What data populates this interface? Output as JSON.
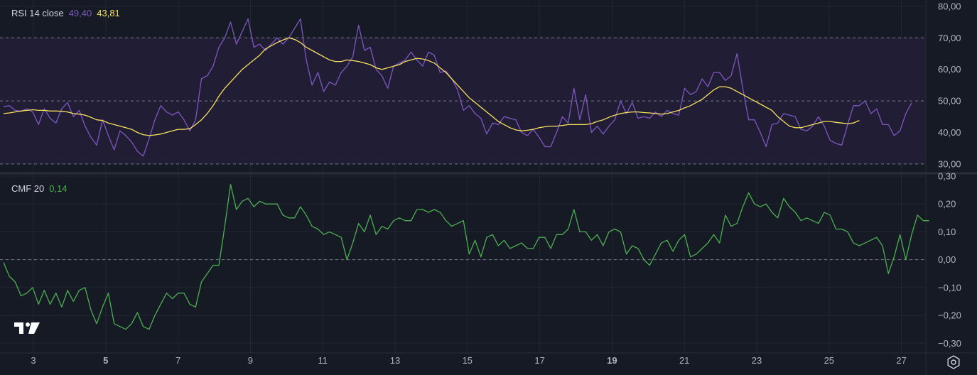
{
  "chart_data": [
    {
      "type": "line",
      "title": "RSI 14 close",
      "indicator": "RSI",
      "legend_values": [
        "49,40",
        "43,81"
      ],
      "y_ticks": [
        "80,00",
        "70,00",
        "60,00",
        "50,00",
        "40,00",
        "30,00"
      ],
      "ylim": [
        27.5,
        82
      ],
      "bands": [
        30,
        50,
        70
      ],
      "series": [
        {
          "color": "#7e57c2",
          "values": [
            48.2,
            48.5,
            47.0,
            46.7,
            47.5,
            46.5,
            42.5,
            47.5,
            44.5,
            43.0,
            47.5,
            49.5,
            45.0,
            47.0,
            42.0,
            38.5,
            36.0,
            44.0,
            39.0,
            34.5,
            40.5,
            39.0,
            37.0,
            34.0,
            32.5,
            38.0,
            44.0,
            48.5,
            46.5,
            45.5,
            46.5,
            44.0,
            40.5,
            44.0,
            57.0,
            58.0,
            61.0,
            67.0,
            70.0,
            75.0,
            68.0,
            72.0,
            76.0,
            67.0,
            68.0,
            66.0,
            68.0,
            70.0,
            68.0,
            70.0,
            73.0,
            76.0,
            63.0,
            55.0,
            59.0,
            53.0,
            56.0,
            55.0,
            59.0,
            61.0,
            64.0,
            74.0,
            66.0,
            67.0,
            60.0,
            58.0,
            54.0,
            61.0,
            62.0,
            63.0,
            65.5,
            63.0,
            61.0,
            65.5,
            64.5,
            59.0,
            59.5,
            57.0,
            53.5,
            47.0,
            48.5,
            46.0,
            44.5,
            39.5,
            43.0,
            42.5,
            45.0,
            44.5,
            44.0,
            40.0,
            39.0,
            41.0,
            38.5,
            35.5,
            35.5,
            40.0,
            45.0,
            43.0,
            54.0,
            44.0,
            52.0,
            40.0,
            42.0,
            39.5,
            42.0,
            44.0,
            50.0,
            46.0,
            49.5,
            44.5,
            45.0,
            44.5,
            46.5,
            45.0,
            47.0,
            46.0,
            45.5,
            54.0,
            52.0,
            53.0,
            57.0,
            54.5,
            59.0,
            59.0,
            56.5,
            58.0,
            65.0,
            54.0,
            44.0,
            44.0,
            40.0,
            35.5,
            42.5,
            43.0,
            46.0,
            45.5,
            45.0,
            41.0,
            40.5,
            42.0,
            45.0,
            42.0,
            37.5,
            36.5,
            36.0,
            42.5,
            48.5,
            48.5,
            50.0,
            46.0,
            47.5,
            42.5,
            42.5,
            39.0,
            40.5,
            46.0,
            49.4
          ]
        },
        {
          "color": "#f7e05c",
          "values": [
            46.0,
            46.2,
            46.5,
            46.8,
            47.0,
            47.2,
            47.0,
            47.0,
            46.8,
            46.8,
            46.7,
            46.5,
            46.0,
            45.8,
            45.5,
            44.8,
            44.0,
            43.8,
            43.0,
            42.5,
            42.0,
            41.5,
            41.0,
            40.0,
            39.3,
            39.0,
            39.2,
            39.5,
            40.0,
            40.5,
            41.0,
            41.0,
            41.2,
            42.5,
            44.0,
            46.0,
            48.5,
            51.5,
            54.0,
            56.0,
            58.0,
            60.0,
            61.5,
            63.0,
            64.5,
            66.5,
            67.5,
            68.5,
            69.3,
            70.0,
            69.5,
            68.5,
            67.0,
            66.0,
            65.0,
            64.0,
            63.0,
            62.5,
            62.5,
            63.0,
            62.8,
            62.5,
            62.0,
            61.5,
            60.5,
            60.0,
            60.5,
            61.0,
            61.5,
            62.5,
            63.0,
            63.5,
            63.3,
            62.8,
            62.0,
            60.5,
            59.0,
            57.0,
            55.0,
            53.0,
            51.0,
            49.5,
            48.0,
            46.5,
            45.0,
            43.5,
            42.5,
            41.5,
            40.8,
            40.5,
            40.7,
            41.0,
            41.5,
            41.8,
            42.0,
            42.0,
            42.2,
            42.5,
            42.5,
            42.5,
            42.5,
            42.8,
            43.5,
            44.0,
            44.8,
            45.5,
            46.0,
            46.3,
            46.5,
            46.5,
            46.3,
            46.2,
            46.0,
            45.8,
            46.0,
            46.5,
            47.0,
            47.8,
            48.5,
            49.5,
            50.5,
            52.0,
            53.5,
            54.5,
            54.5,
            54.0,
            53.0,
            52.0,
            51.0,
            50.0,
            49.0,
            48.0,
            47.0,
            45.0,
            43.5,
            42.0,
            41.5,
            41.5,
            42.0,
            42.5,
            43.0,
            43.5,
            43.5,
            43.2,
            43.0,
            42.8,
            43.0,
            43.81
          ]
        }
      ]
    },
    {
      "type": "line",
      "title": "CMF 20",
      "indicator": "CMF",
      "legend_values": [
        "0,14"
      ],
      "y_ticks": [
        "0,30",
        "0,20",
        "0,10",
        "0,00",
        "−0,10",
        "−0,20",
        "−0,30"
      ],
      "ylim": [
        -0.335,
        0.305
      ],
      "zero_line": 0,
      "series": [
        {
          "color": "#4caf50",
          "values": [
            -0.01,
            -0.06,
            -0.08,
            -0.13,
            -0.12,
            -0.1,
            -0.16,
            -0.11,
            -0.16,
            -0.12,
            -0.17,
            -0.11,
            -0.15,
            -0.11,
            -0.1,
            -0.18,
            -0.23,
            -0.17,
            -0.12,
            -0.23,
            -0.24,
            -0.25,
            -0.23,
            -0.19,
            -0.24,
            -0.25,
            -0.2,
            -0.16,
            -0.12,
            -0.14,
            -0.12,
            -0.12,
            -0.16,
            -0.17,
            -0.08,
            -0.05,
            -0.02,
            -0.02,
            0.12,
            0.27,
            0.18,
            0.21,
            0.22,
            0.19,
            0.21,
            0.2,
            0.2,
            0.2,
            0.16,
            0.15,
            0.15,
            0.19,
            0.16,
            0.12,
            0.11,
            0.09,
            0.1,
            0.09,
            0.08,
            0.0,
            0.06,
            0.13,
            0.1,
            0.16,
            0.09,
            0.12,
            0.11,
            0.14,
            0.15,
            0.14,
            0.14,
            0.18,
            0.18,
            0.17,
            0.18,
            0.17,
            0.14,
            0.12,
            0.13,
            0.14,
            0.02,
            0.07,
            0.01,
            0.08,
            0.09,
            0.05,
            0.07,
            0.04,
            0.05,
            0.06,
            0.04,
            0.04,
            0.08,
            0.08,
            0.04,
            0.09,
            0.09,
            0.11,
            0.18,
            0.1,
            0.1,
            0.07,
            0.09,
            0.05,
            0.1,
            0.11,
            0.1,
            0.02,
            0.05,
            0.04,
            0.0,
            -0.02,
            0.02,
            0.06,
            0.07,
            0.03,
            0.07,
            0.09,
            0.01,
            0.02,
            0.04,
            0.06,
            0.09,
            0.06,
            0.16,
            0.12,
            0.13,
            0.19,
            0.24,
            0.2,
            0.19,
            0.2,
            0.17,
            0.15,
            0.22,
            0.19,
            0.17,
            0.14,
            0.15,
            0.14,
            0.13,
            0.17,
            0.16,
            0.11,
            0.11,
            0.1,
            0.06,
            0.05,
            0.06,
            0.07,
            0.08,
            0.05,
            -0.05,
            0.01,
            0.09,
            0.0,
            0.09,
            0.16,
            0.14,
            0.14
          ]
        }
      ]
    }
  ],
  "x_axis": {
    "labels": [
      {
        "text": "3",
        "bold": false
      },
      {
        "text": "5",
        "bold": true
      },
      {
        "text": "7",
        "bold": false
      },
      {
        "text": "9",
        "bold": false
      },
      {
        "text": "11",
        "bold": false
      },
      {
        "text": "13",
        "bold": false
      },
      {
        "text": "15",
        "bold": false
      },
      {
        "text": "17",
        "bold": false
      },
      {
        "text": "19",
        "bold": true
      },
      {
        "text": "21",
        "bold": false
      },
      {
        "text": "23",
        "bold": false
      },
      {
        "text": "25",
        "bold": false
      },
      {
        "text": "27",
        "bold": false
      }
    ]
  },
  "colors": {
    "background": "#161a25",
    "grid": "#232733",
    "axis_text": "#b2b5be",
    "rsi_line": "#7e57c2",
    "rsi_ma": "#f7e05c",
    "cmf_line": "#4caf50",
    "band_fill": "#211d35"
  },
  "icons": {
    "logo": "tradingview-logo",
    "settings": "settings-gear-icon"
  }
}
